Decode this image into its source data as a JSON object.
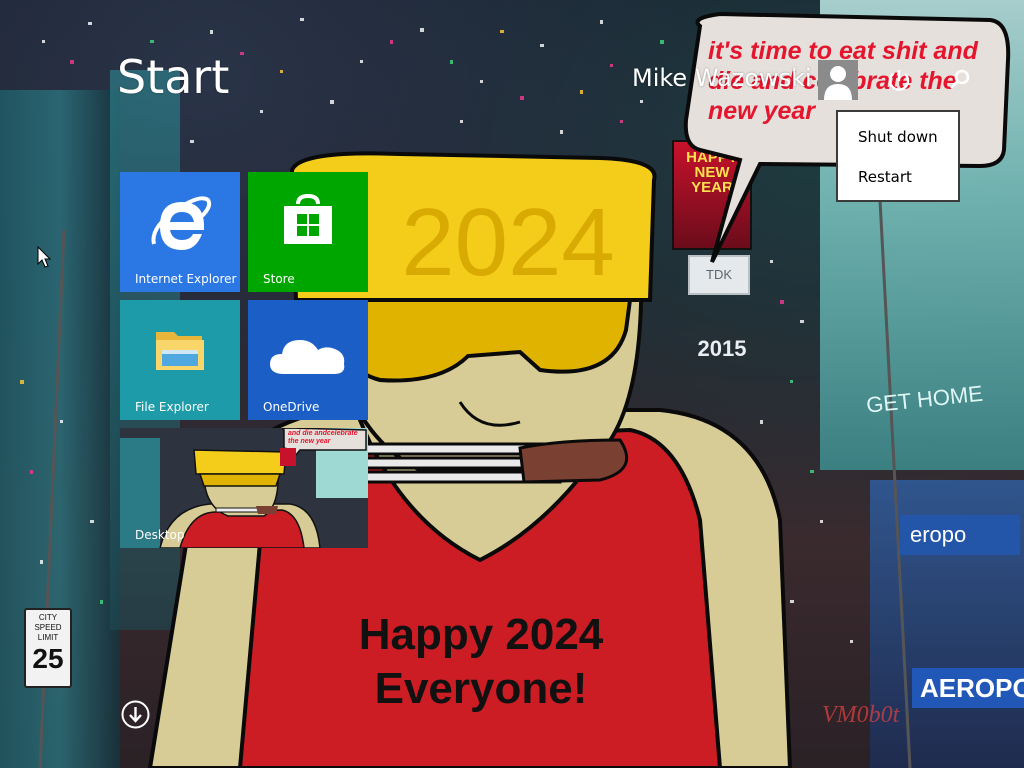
{
  "start": {
    "title": "Start"
  },
  "user": {
    "name": "Mike Wazowski",
    "avatar_icon": "user-silhouette-icon"
  },
  "header_icons": {
    "power": "power-icon",
    "search": "search-icon"
  },
  "power_menu": {
    "items": [
      {
        "label": "Shut down"
      },
      {
        "label": "Restart"
      }
    ]
  },
  "tiles": [
    {
      "label": "Internet Explorer",
      "icon": "internet-explorer-icon",
      "color": "#2b78e4"
    },
    {
      "label": "Store",
      "icon": "store-icon",
      "color": "#00a600"
    },
    {
      "label": "File Explorer",
      "icon": "folder-icon",
      "color": "#1d9ba9"
    },
    {
      "label": "OneDrive",
      "icon": "cloud-icon",
      "color": "#1b5fc6"
    },
    {
      "label": "Desktop",
      "icon": "desktop-wallpaper-thumbnail",
      "color": "#3a3440"
    }
  ],
  "apps_arrow": {
    "icon": "down-arrow-circle-icon"
  },
  "wallpaper": {
    "speech_bubble_text": "it's time to eat shit and die and celebrate the new year",
    "hat_text": "2024",
    "shirt_line_1": "Happy 2024",
    "shirt_line_2": "Everyone!",
    "billboard_text": "HAPPY NEW YEAR",
    "sign_tdk": "TDK",
    "sign_year": "2015",
    "sign_gethome": "GET HOME",
    "sign_aero_1": "eropo",
    "sign_aero_2": "AEROPOS",
    "speed_sign_top": "CITY SPEED LIMIT",
    "speed_sign_value": "25",
    "watermark": "VM0b0t",
    "desktop_thumb_text": "and die andcelebrate the new year"
  },
  "colors": {
    "ie_tile": "#2b78e4",
    "store_tile": "#00a600",
    "explorer_tile": "#1d9ba9",
    "onedrive_tile": "#1b5fc6",
    "shirt_red": "#cc1d24",
    "hat_yellow": "#f3cd1a",
    "skin": "#d7cc95"
  }
}
